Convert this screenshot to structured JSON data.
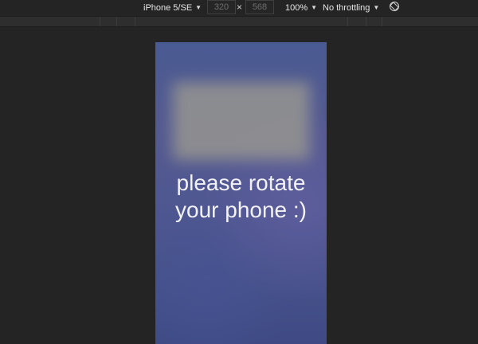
{
  "toolbar": {
    "device": "iPhone 5/SE",
    "width_value": "320",
    "height_value": "568",
    "times": "×",
    "zoom": "100%",
    "throttling": "No throttling",
    "caret": "▼",
    "rotate_icon": "rotate-icon"
  },
  "phone_screen": {
    "message_line1": "please rotate",
    "message_line2": "your phone :)"
  },
  "colors": {
    "background": "#242424",
    "toolbar_text": "#e6e6e6",
    "phone_bg": "#4f5791",
    "message_text": "#f2f2f6"
  }
}
